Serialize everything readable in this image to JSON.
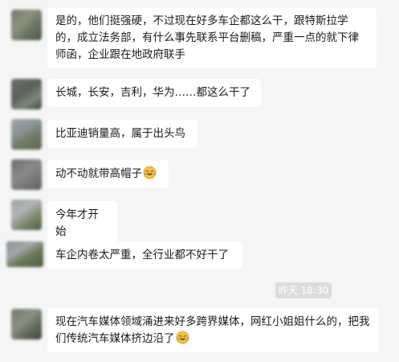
{
  "messages": [
    {
      "text": "是的，他们挺强硬，不过现在好多车企都这么干，跟特斯拉学的，成立法务部，有什么事先联系平台删稿，严重一点的就下律师函，企业跟在地政府联手"
    },
    {
      "text": "长城，长安，吉利，华为……都这么干了"
    },
    {
      "text": "比亚迪销量高，属于出头鸟"
    },
    {
      "text": "动不动就带高帽子",
      "emoji": "laughing-crying-emoji"
    },
    {
      "text": "今年才开始"
    },
    {
      "text": "车企内卷太严重，全行业都不好干了"
    },
    {
      "text": "现在汽车媒体领域涌进来好多跨界媒体，网红小姐姐什么的，把我们传统汽车媒体挤边沿了",
      "emoji": "laughing-crying-emoji"
    }
  ],
  "timestamp": "昨天 18:30",
  "colors": {
    "background": "#f5f5f5",
    "bubble": "#ffffff",
    "timestamp_chip": "#dcdcdc",
    "timestamp_text": "#ffffff"
  }
}
